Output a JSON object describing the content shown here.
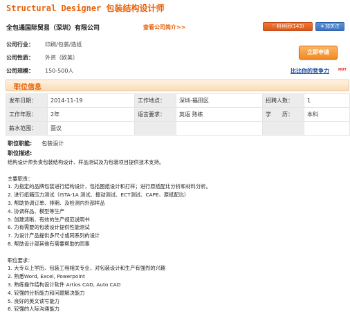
{
  "job_title": "Structural Designer 包装结构设计师",
  "company": {
    "name": "全包通国际贸易（深圳）有限公司",
    "view_link": "查看公司简介>>",
    "fans_label": "粉丝团(143)",
    "follow_label": "加关注",
    "info": [
      {
        "label": "公司行业：",
        "value": "印刷/包装/造纸"
      },
      {
        "label": "公司性质：",
        "value": "外资（欧美）"
      },
      {
        "label": "公司规模：",
        "value": "150-500人"
      }
    ]
  },
  "apply_label": "立即申请",
  "compare_label": "比比你的竞争力",
  "hot_label": "HOT",
  "section_title": "职位信息",
  "job_info": {
    "rows": [
      [
        {
          "k": "发布日期：",
          "v": "2014-11-19"
        },
        {
          "k": "工作地点：",
          "v": "深圳-福田区"
        },
        {
          "k": "招聘人数：",
          "v": "1"
        }
      ],
      [
        {
          "k": "工作年限：",
          "v": "2年"
        },
        {
          "k": "语言要求：",
          "v": "英语 熟练"
        },
        {
          "k": "学　　历：",
          "v": "本科"
        }
      ],
      [
        {
          "k": "薪水范围：",
          "v": "面议"
        },
        {
          "k": "",
          "v": ""
        },
        {
          "k": "",
          "v": ""
        }
      ]
    ]
  },
  "duty_label": "职位职能:",
  "duty_value": "包装设计",
  "desc_label": "职位描述:",
  "desc_lines": [
    "结构设计师负责包装结构设计、样品测试及为包装项目提供技术支持。",
    "",
    "主要职责：",
    "1. 为指定的品牌包装进行结构设计，包括图纸设计和打样；进行原纸配比分析和材料分析。",
    "2. 进行纸箱压力测试（ISTA-1A 测试、振动测试、ECT测试、CAPE、原纸配比）",
    "3. 帮助协调订单、排期、及检测内外部样品",
    "4. 协调样品、模型等生产",
    "5. 创建清晰、有效的生产规范说明书",
    "6. 为有需要的包装设计提供性能测试",
    "7. 为设计产品提供多尺寸或同系列的设计",
    "8. 帮助设计部其他有需要帮助的同事",
    "",
    "职位要求：",
    "1. 大专以上学历、包装工程相关专业，对包装设计和生产有强烈的兴趣",
    "2. 熟悉Word, Excel, Powerpoint",
    "3. 熟练操作结构设计软件 Artios CAD, Auto CAD",
    "4. 较强的分析能力和问题解决能力",
    "5. 良好的英文读写能力",
    "6. 较强的人际沟通能力"
  ]
}
